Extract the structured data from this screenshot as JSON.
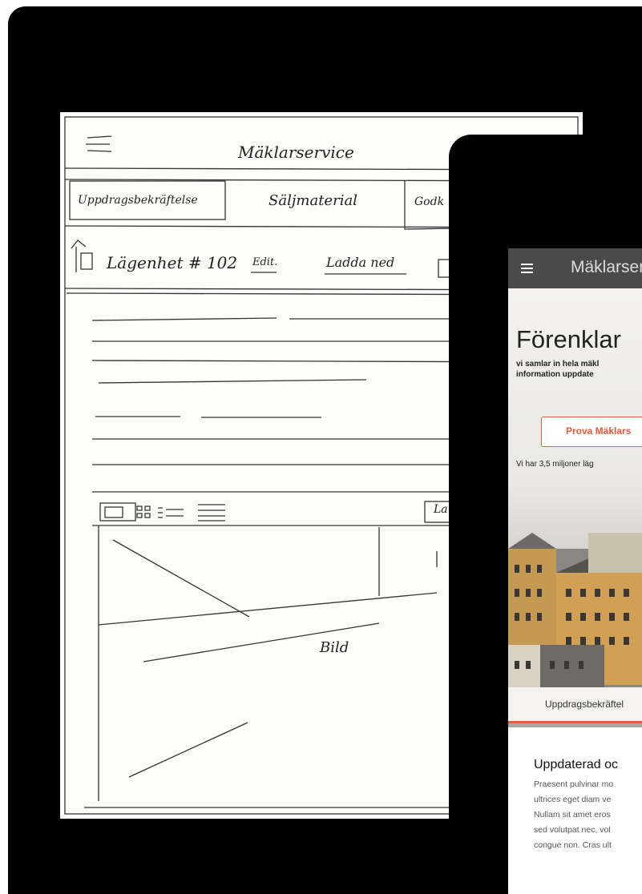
{
  "sketch": {
    "app_title": "Mäklarservice",
    "tabs": [
      "Uppdragsbekräftelse",
      "Säljmaterial",
      "Godk"
    ],
    "listing_title": "Lägenhet # 102",
    "edit_link": "Edit.",
    "download_link": "Ladda ned",
    "image_label": "Bild",
    "button_fragment": "La"
  },
  "app": {
    "title": "Mäklarservice",
    "hero_title": "Förenklar",
    "hero_subtitle_lines": [
      "vi samlar in hela mäkl",
      "information uppdate"
    ],
    "cta_label": "Prova Mäklars",
    "stat_text": "Vi har 3,5 miljoner läg",
    "home_icon": "home-icon",
    "hero_caption": "Uppdragsbekräftel",
    "article_title": "Uppdaterad oc",
    "article_lines": [
      "Praesent pulvinar mo",
      "ultrices eget diam ve",
      "Nullam sit amet eros",
      "sed volutpat nec, vol",
      "congue non. Cras ult"
    ]
  },
  "colors": {
    "accent": "#e05c3c",
    "appbar": "#4a4a4a",
    "device": "#000000"
  }
}
